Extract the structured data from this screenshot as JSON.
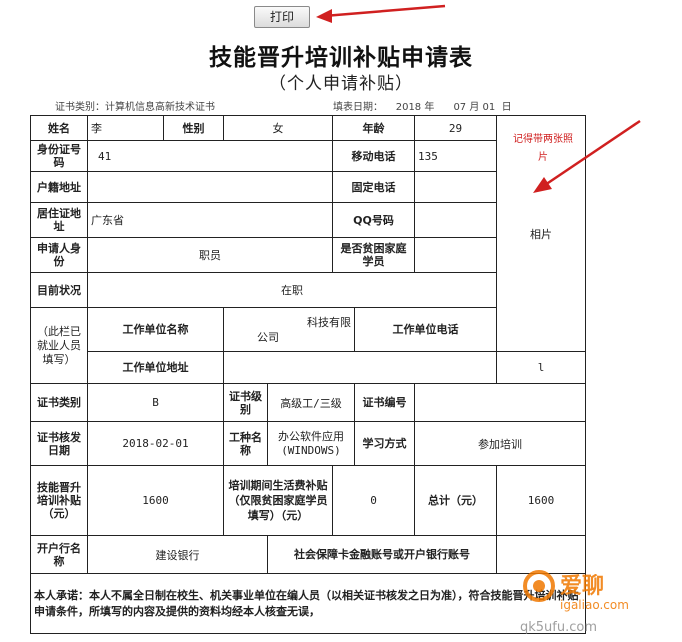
{
  "toolbar": {
    "print_label": "打印"
  },
  "header": {
    "title": "技能晋升培训补贴申请表",
    "subtitle": "（个人申请补贴）",
    "cert_category_label": "证书类别：",
    "cert_category_value": "计算机信息高新技术证书",
    "fill_date_label": "填表日期：",
    "fill_date_year": "2018 年",
    "fill_date_month": "07 月 01",
    "fill_date_day": "日"
  },
  "form": {
    "name_label": "姓名",
    "name_value": "李",
    "gender_label": "性别",
    "gender_value": "女",
    "age_label": "年龄",
    "age_value": "29",
    "id_label": "身份证号码",
    "id_value": "41",
    "mobile_label": "移动电话",
    "mobile_value": "135",
    "hukou_label": "户籍地址",
    "landline_label": "固定电话",
    "residence_label": "居住证地址",
    "residence_value": "广东省",
    "qq_label": "QQ号码",
    "photo_label": "相片",
    "applicant_identity_label": "申请人身份",
    "applicant_identity_value": "职员",
    "poor_family_label": "是否贫困家庭学员",
    "status_label": "目前状况",
    "status_value": "在职",
    "employed_note_label": "（此栏已就业人员填写）",
    "employer_name_label": "工作单位名称",
    "employer_name_value_1": "科技有限",
    "employer_name_value_2": "公司",
    "employer_phone_label": "工作单位电话",
    "employer_phone_value": "l",
    "employer_address_label": "工作单位地址",
    "cert_type_label": "证书类别",
    "cert_type_value": "B",
    "cert_level_label": "证书级别",
    "cert_level_value": "高级工/三级",
    "cert_number_label": "证书编号",
    "cert_issue_date_label": "证书核发日期",
    "cert_issue_date_value": "2018-02-01",
    "job_type_label": "工种名称",
    "job_type_value_1": "办公软件应用",
    "job_type_value_2": "(WINDOWS)",
    "study_mode_label": "学习方式",
    "study_mode_value": "参加培训",
    "subsidy_label": "技能晋升培训补贴（元）",
    "subsidy_value": "1600",
    "living_subsidy_label": "培训期间生活费补贴（仅限贫困家庭学员填写）（元）",
    "living_subsidy_value": "0",
    "total_label": "总计（元）",
    "total_value": "1600",
    "bank_label": "开户行名称",
    "bank_value": "建设银行",
    "account_label": "社会保障卡金融账号或开户银行账号",
    "commitment_text": "本人承诺：本人不属全日制在校生、机关事业单位在编人员（以相关证书核发之日为准），符合技能晋升培训补贴申请条件，所填写的内容及提供的资料均经本人核查无误，"
  },
  "annotation": {
    "note_text": "记得带两张照片",
    "color": "#d02020"
  },
  "watermark": {
    "text": "爱聊",
    "url": "igaliao.com",
    "url2": "qk5ufu.com",
    "color": "#f07800"
  }
}
